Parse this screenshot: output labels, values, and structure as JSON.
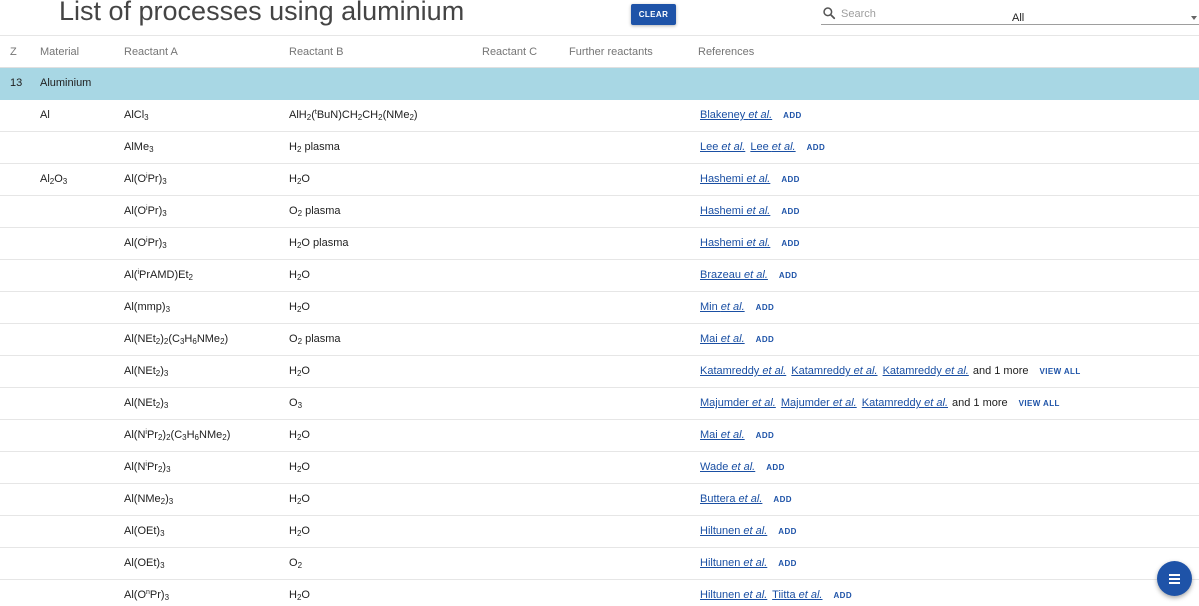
{
  "header": {
    "title": "List of processes using aluminium",
    "clear_label": "CLEAR",
    "search_placeholder": "Search",
    "filter_value": "All"
  },
  "columns": [
    "Z",
    "Material",
    "Reactant A",
    "Reactant B",
    "Reactant C",
    "Further reactants",
    "References"
  ],
  "group": {
    "z": "13",
    "name": "Aluminium"
  },
  "rows": [
    {
      "material": "Al",
      "reactant_a": "AlCl<sub>3</sub>",
      "reactant_b": "AlH<sub>2</sub>(<sup>t</sup>BuN)CH<sub>2</sub>CH<sub>2</sub>(NMe<sub>2</sub>)",
      "refs": [
        "Blakeney"
      ],
      "more": "",
      "action": "ADD"
    },
    {
      "material": "",
      "reactant_a": "AlMe<sub>3</sub>",
      "reactant_b": "H<sub>2</sub> plasma",
      "refs": [
        "Lee",
        "Lee"
      ],
      "more": "",
      "action": "ADD"
    },
    {
      "material": "Al<sub>2</sub>O<sub>3</sub>",
      "reactant_a": "Al(O<sup>i</sup>Pr)<sub>3</sub>",
      "reactant_b": "H<sub>2</sub>O",
      "refs": [
        "Hashemi"
      ],
      "more": "",
      "action": "ADD"
    },
    {
      "material": "",
      "reactant_a": "Al(O<sup>i</sup>Pr)<sub>3</sub>",
      "reactant_b": "O<sub>2</sub> plasma",
      "refs": [
        "Hashemi"
      ],
      "more": "",
      "action": "ADD"
    },
    {
      "material": "",
      "reactant_a": "Al(O<sup>i</sup>Pr)<sub>3</sub>",
      "reactant_b": "H<sub>2</sub>O plasma",
      "refs": [
        "Hashemi"
      ],
      "more": "",
      "action": "ADD"
    },
    {
      "material": "",
      "reactant_a": "Al(<sup>i</sup>PrAMD)Et<sub>2</sub>",
      "reactant_b": "H<sub>2</sub>O",
      "refs": [
        "Brazeau"
      ],
      "more": "",
      "action": "ADD"
    },
    {
      "material": "",
      "reactant_a": "Al(mmp)<sub>3</sub>",
      "reactant_b": "H<sub>2</sub>O",
      "refs": [
        "Min"
      ],
      "more": "",
      "action": "ADD"
    },
    {
      "material": "",
      "reactant_a": "Al(NEt<sub>2</sub>)<sub>2</sub>(C<sub>3</sub>H<sub>6</sub>NMe<sub>2</sub>)",
      "reactant_b": "O<sub>2</sub> plasma",
      "refs": [
        "Mai"
      ],
      "more": "",
      "action": "ADD"
    },
    {
      "material": "",
      "reactant_a": "Al(NEt<sub>2</sub>)<sub>3</sub>",
      "reactant_b": "H<sub>2</sub>O",
      "refs": [
        "Katamreddy",
        "Katamreddy",
        "Katamreddy"
      ],
      "more": "and 1 more",
      "action": "VIEW ALL"
    },
    {
      "material": "",
      "reactant_a": "Al(NEt<sub>2</sub>)<sub>3</sub>",
      "reactant_b": "O<sub>3</sub>",
      "refs": [
        "Majumder",
        "Majumder",
        "Katamreddy"
      ],
      "more": "and 1 more",
      "action": "VIEW ALL"
    },
    {
      "material": "",
      "reactant_a": "Al(N<sup>i</sup>Pr<sub>2</sub>)<sub>2</sub>(C<sub>3</sub>H<sub>6</sub>NMe<sub>2</sub>)",
      "reactant_b": "H<sub>2</sub>O",
      "refs": [
        "Mai"
      ],
      "more": "",
      "action": "ADD"
    },
    {
      "material": "",
      "reactant_a": "Al(N<sup>i</sup>Pr<sub>2</sub>)<sub>3</sub>",
      "reactant_b": "H<sub>2</sub>O",
      "refs": [
        "Wade"
      ],
      "more": "",
      "action": "ADD"
    },
    {
      "material": "",
      "reactant_a": "Al(NMe<sub>2</sub>)<sub>3</sub>",
      "reactant_b": "H<sub>2</sub>O",
      "refs": [
        "Buttera"
      ],
      "more": "",
      "action": "ADD"
    },
    {
      "material": "",
      "reactant_a": "Al(OEt)<sub>3</sub>",
      "reactant_b": "H<sub>2</sub>O",
      "refs": [
        "Hiltunen"
      ],
      "more": "",
      "action": "ADD"
    },
    {
      "material": "",
      "reactant_a": "Al(OEt)<sub>3</sub>",
      "reactant_b": "O<sub>2</sub>",
      "refs": [
        "Hiltunen"
      ],
      "more": "",
      "action": "ADD"
    },
    {
      "material": "",
      "reactant_a": "Al(O<sup>n</sup>Pr)<sub>3</sub>",
      "reactant_b": "H<sub>2</sub>O",
      "refs": [
        "Hiltunen",
        "Tiitta"
      ],
      "more": "",
      "action": "ADD"
    }
  ],
  "etal": "et al.",
  "icons": {
    "search": "search-icon",
    "dropdown": "chevron-down-icon",
    "fab": "menu-icon"
  },
  "colors": {
    "primary": "#1e53a8",
    "group_row": "#a8d7e4",
    "link": "#1a4fa3"
  }
}
